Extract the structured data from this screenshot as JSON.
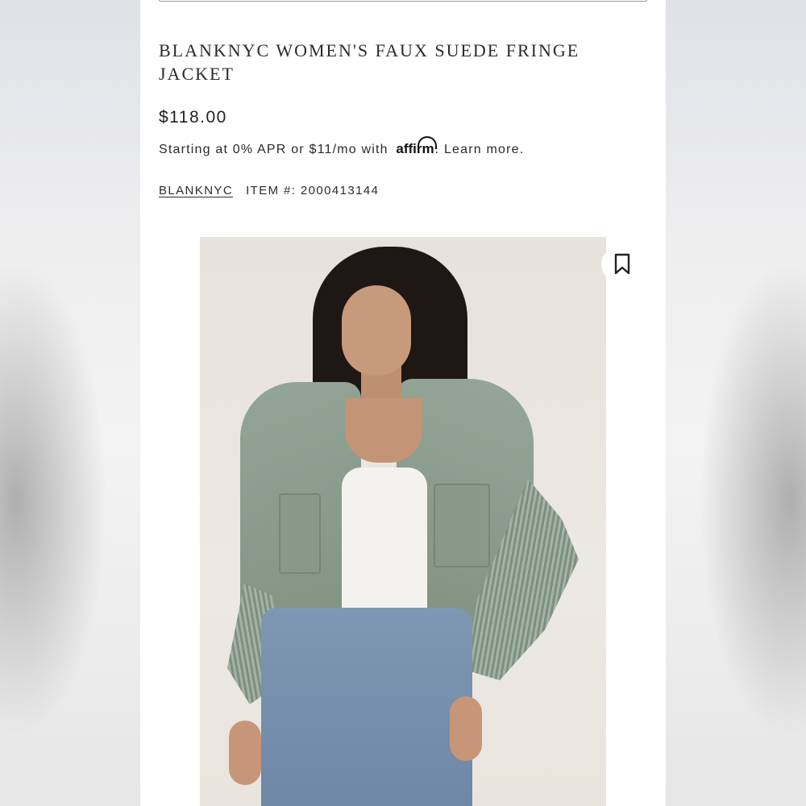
{
  "product": {
    "title": "BLANKNYC WOMEN'S FAUX SUEDE FRINGE JACKET",
    "price": "$118.00",
    "financing": {
      "prefix": "Starting at 0% APR or $11/mo with ",
      "provider_logo": "affirm",
      "suffix": ". ",
      "learn_more": "Learn more."
    },
    "brand_link": "BLANKNYC",
    "item_number": "ITEM #: 2000413144"
  },
  "image": {
    "alt": "Model wearing sage green faux suede fringe jacket with white top and blue jeans",
    "bookmark_icon": "bookmark-icon"
  },
  "colors": {
    "text": "#2b2b2b",
    "jacket": "#8a9d8c",
    "photo_bg": "#e9e5de"
  }
}
